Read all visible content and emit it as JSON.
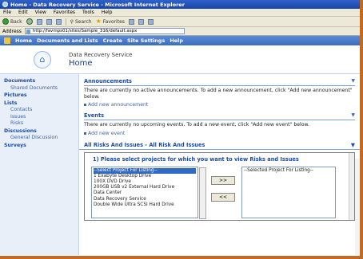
{
  "window": {
    "title": "Home - Data Recovery Service - Microsoft Internet Explorer"
  },
  "menubar": [
    "File",
    "Edit",
    "View",
    "Favorites",
    "Tools",
    "Help"
  ],
  "toolbar": {
    "back": "Back",
    "search": "Search",
    "favorites": "Favorites"
  },
  "addressbar": {
    "label": "Address",
    "url": "http://favmps01/sites/Sample_316/default.aspx"
  },
  "topnav": [
    "Home",
    "Documents and Lists",
    "Create",
    "Site Settings",
    "Help"
  ],
  "header": {
    "site_name": "Data Recovery Service",
    "page_title": "Home"
  },
  "quicklaunch": {
    "documents": "Documents",
    "shared_documents": "Shared Documents",
    "pictures": "Pictures",
    "lists": "Lists",
    "contacts": "Contacts",
    "issues": "Issues",
    "risks": "Risks",
    "discussions": "Discussions",
    "general_discussion": "General Discussion",
    "surveys": "Surveys"
  },
  "announcements": {
    "title": "Announcements",
    "text": "There are currently no active announcements. To add a new announcement, click \"Add new announcement\" below.",
    "link": "Add new announcement"
  },
  "events": {
    "title": "Events",
    "text": "There are currently no upcoming events. To add a new event, click \"Add new event\" below.",
    "link": "Add new event"
  },
  "risks": {
    "title": "All Risks And Issues - All Risk And Issues",
    "heading": "1) Please select projects for which you want to view Risks and Issues",
    "available": [
      "--Select Project For Listing--",
      "1 Exabyte Desktop Drive",
      "100X DVD Drive",
      "200GB USB v2 External Hard Drive",
      "Data Center",
      "Data Recovery Service",
      "Double Wide Ultra SCSI Hard Drive"
    ],
    "selected": [
      "--Selected Project For Listing--"
    ],
    "add_button": ">>",
    "remove_button": "<<"
  }
}
